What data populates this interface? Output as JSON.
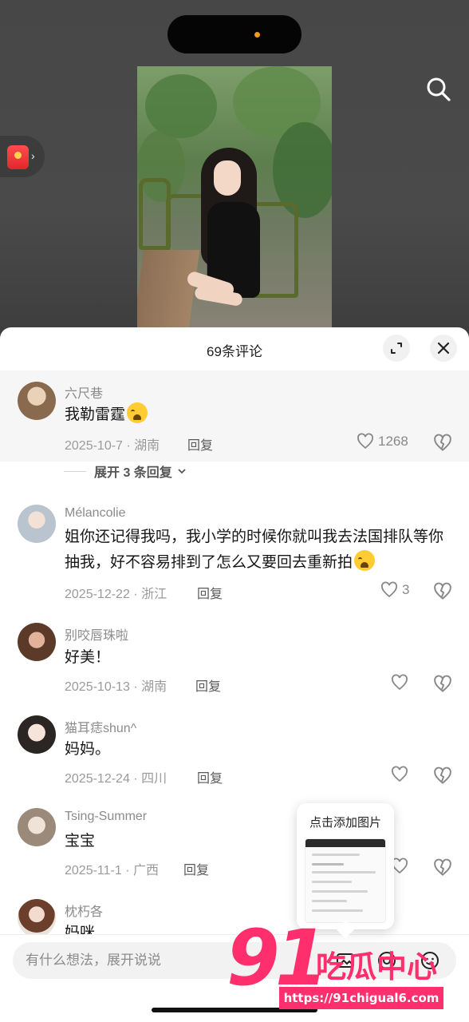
{
  "status": {
    "island_dot_color": "#f29a1f"
  },
  "video": {
    "search_icon": "search-icon",
    "redpacket_icon": "red-packet-icon"
  },
  "sheet": {
    "title": "69条评论",
    "expand_icon": "expand-icon",
    "close_icon": "close-icon"
  },
  "comments": [
    {
      "user": "六尺巷",
      "text": "我勒雷霆",
      "emoji": "crying-laughing-emoji",
      "date_location": "2025-10-7 · 湖南",
      "reply_label": "回复",
      "likes": "1268",
      "expand_replies": "展开 3 条回复"
    },
    {
      "user": "Mélancolie",
      "text": "姐你还记得我吗，我小学的时候你就叫我去法国排队等你抽我，好不容易排到了怎么又要回去重新拍",
      "emoji": "crying-emoji",
      "date_location": "2025-12-22 · 浙江",
      "reply_label": "回复",
      "likes": "3"
    },
    {
      "user": "别咬唇珠啦",
      "text": "好美！",
      "date_location": "2025-10-13 · 湖南",
      "reply_label": "回复",
      "likes": ""
    },
    {
      "user": "猫耳痣shun^",
      "text": "妈妈。",
      "date_location": "2025-12-24 · 四川",
      "reply_label": "回复",
      "likes": ""
    },
    {
      "user": "Tsing-Summer",
      "text": "宝宝",
      "date_location": "2025-11-1 · 广西",
      "reply_label": "回复",
      "likes": ""
    },
    {
      "user": "枕朽各",
      "text": "妈咪"
    }
  ],
  "tooltip": {
    "title": "点击添加图片"
  },
  "input": {
    "placeholder": "有什么想法，展开说说",
    "value": "",
    "icons": [
      "image-icon",
      "at-icon",
      "emoji-icon"
    ]
  },
  "watermark": {
    "number": "91",
    "brand": "吃瓜中心",
    "url": "https://91chigual6.com"
  }
}
